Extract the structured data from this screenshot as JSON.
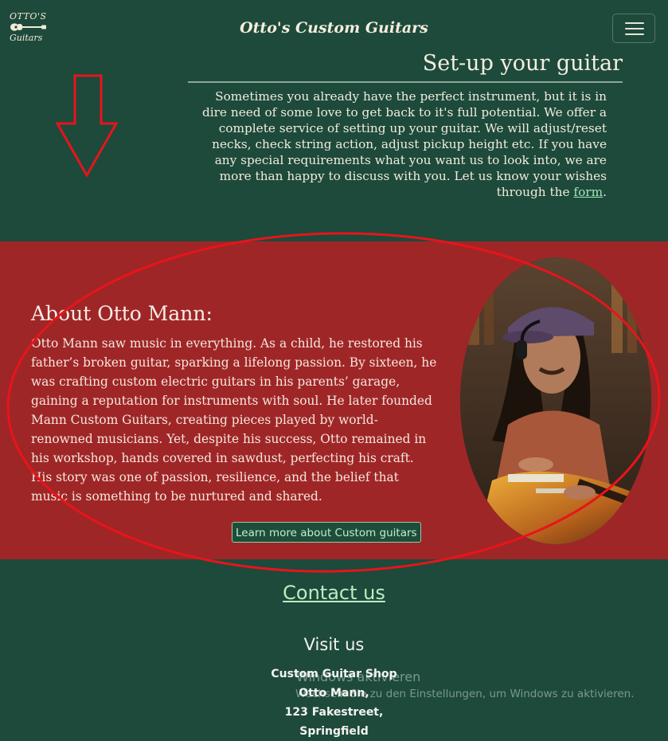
{
  "header": {
    "logo_top": "OTTO'S",
    "logo_bottom": "Guitars",
    "brand": "Otto's Custom Guitars"
  },
  "setup": {
    "title": "Set-up your guitar",
    "text": "Sometimes you already have the perfect instrument, but it is in dire need of some love to get back to it's full potential. We offer a complete service of setting up your guitar. We will adjust/reset necks, check string action, adjust pickup height etc. If you have any special requirements what you want us to look into, we are more than happy to discuss with you. Let us know your wishes through the ",
    "link_text": "form",
    "text_end": "."
  },
  "about": {
    "title": "About Otto Mann:",
    "text": "Otto Mann saw music in everything. As a child, he restored his father’s broken guitar, sparking a lifelong passion. By sixteen, he was crafting custom electric guitars in his parents’ garage, gaining a reputation for instruments with soul. He later founded Mann Custom Guitars, creating pieces played by world-renowned musicians. Yet, despite his success, Otto remained in his workshop, hands covered in sawdust, perfecting his craft. His story was one of passion, resilience, and the belief that music is something to be nurtured and shared.",
    "button": "Learn more about Custom guitars"
  },
  "contact": {
    "link": "Contact us",
    "visit_title": "Visit us",
    "address": [
      "Custom Guitar Shop",
      "Otto Mann,",
      "123 Fakestreet,",
      "Springfield"
    ]
  },
  "watermark": {
    "line1": "Windows aktivieren",
    "line2": "Wechseln Sie zu den Einstellungen, um Windows zu aktivieren."
  },
  "colors": {
    "background": "#1d4a3b",
    "about_background": "#9f2627",
    "link": "#a4e6b8",
    "annotation": "#e8141b"
  },
  "icons": [
    "guitar-logo-icon",
    "hamburger-menu-icon",
    "down-arrow-annotation",
    "ellipse-annotation"
  ]
}
